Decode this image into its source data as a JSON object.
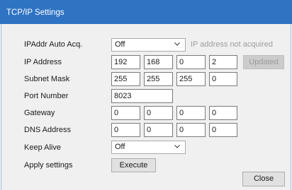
{
  "window": {
    "title": "TCP/IP Settings"
  },
  "form": {
    "ipaddr_auto": {
      "label": "IPAddr Auto Acq.",
      "value": "Off",
      "hint": "IP address not acquired"
    },
    "ip_address": {
      "label": "IP Address",
      "octets": [
        "192",
        "168",
        "0",
        "2"
      ],
      "button": "Updated"
    },
    "subnet_mask": {
      "label": "Subnet Mask",
      "octets": [
        "255",
        "255",
        "255",
        "0"
      ]
    },
    "port_number": {
      "label": "Port Number",
      "value": "8023"
    },
    "gateway": {
      "label": "Gateway",
      "octets": [
        "0",
        "0",
        "0",
        "0"
      ]
    },
    "dns_address": {
      "label": "DNS Address",
      "octets": [
        "0",
        "0",
        "0",
        "0"
      ]
    },
    "keep_alive": {
      "label": "Keep Alive",
      "value": "Off"
    },
    "apply": {
      "label": "Apply settings",
      "button": "Execute"
    }
  },
  "footer": {
    "close_button": "Close"
  }
}
